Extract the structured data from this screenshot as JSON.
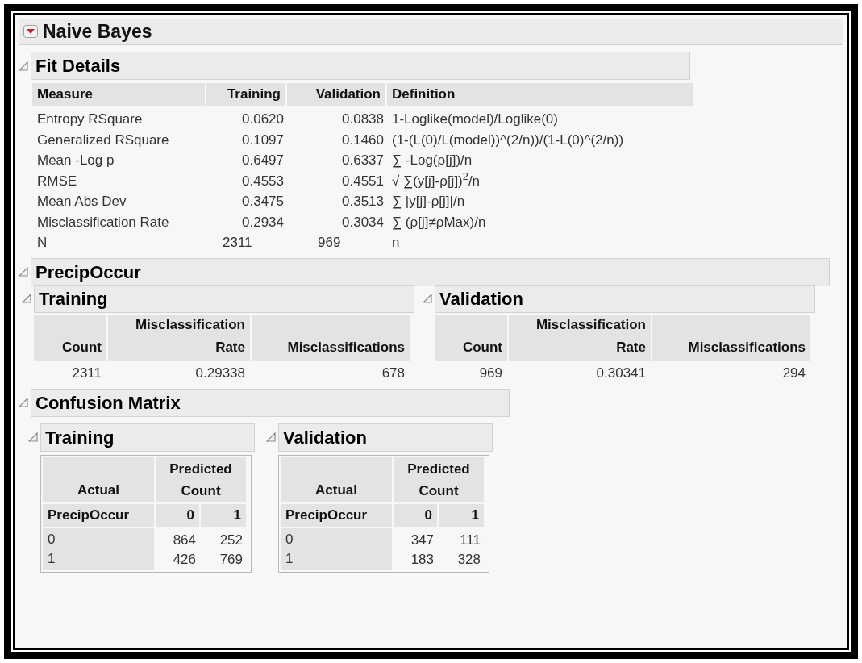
{
  "report": {
    "title": "Naive Bayes"
  },
  "fit_details": {
    "title": "Fit Details",
    "columns": [
      "Measure",
      "Training",
      "Validation",
      "Definition"
    ],
    "rows": [
      {
        "kind": "decimal",
        "measure": "Entropy RSquare",
        "training": "0.0620",
        "validation": "0.0838",
        "definition": "1-Loglike(model)/Loglike(0)"
      },
      {
        "kind": "decimal",
        "measure": "Generalized RSquare",
        "training": "0.1097",
        "validation": "0.1460",
        "definition": "(1-(L(0)/L(model))^(2/n))/(1-L(0)^(2/n))"
      },
      {
        "kind": "decimal",
        "measure": "Mean -Log p",
        "training": "0.6497",
        "validation": "0.6337",
        "definition": "∑ -Log(ρ[j])/n"
      },
      {
        "kind": "decimal",
        "measure": "RMSE",
        "training": "0.4553",
        "validation": "0.4551",
        "definition": "√ ∑(y[j]-ρ[j])$^{2}$/n"
      },
      {
        "kind": "decimal",
        "measure": "Mean Abs Dev",
        "training": "0.3475",
        "validation": "0.3513",
        "definition": "∑ |y[j]-ρ[j]|/n"
      },
      {
        "kind": "decimal",
        "measure": "Misclassification Rate",
        "training": "0.2934",
        "validation": "0.3034",
        "definition": "∑ (ρ[j]≠ρMax)/n"
      },
      {
        "kind": "count",
        "measure": "N",
        "training": "2311",
        "validation": "969",
        "definition": "n"
      }
    ]
  },
  "precip_occur": {
    "title": "PrecipOccur",
    "panels": [
      {
        "title": "Training",
        "columns": [
          "Count",
          "Misclassification Rate",
          "Misclassifications"
        ],
        "values": [
          "2311",
          "0.29338",
          "678"
        ]
      },
      {
        "title": "Validation",
        "columns": [
          "Count",
          "Misclassification Rate",
          "Misclassifications"
        ],
        "values": [
          "969",
          "0.30341",
          "294"
        ]
      }
    ]
  },
  "confusion_matrix": {
    "title": "Confusion Matrix",
    "panels": [
      {
        "title": "Training",
        "actual_label": "Actual",
        "predicted_label": "Predicted Count",
        "row_header": "PrecipOccur",
        "levels": [
          "0",
          "1"
        ],
        "rows": [
          {
            "label": "0",
            "values": [
              "864",
              "252"
            ]
          },
          {
            "label": "1",
            "values": [
              "426",
              "769"
            ]
          }
        ]
      },
      {
        "title": "Validation",
        "actual_label": "Actual",
        "predicted_label": "Predicted Count",
        "row_header": "PrecipOccur",
        "levels": [
          "0",
          "1"
        ],
        "rows": [
          {
            "label": "0",
            "values": [
              "347",
              "111"
            ]
          },
          {
            "label": "1",
            "values": [
              "183",
              "328"
            ]
          }
        ]
      }
    ]
  }
}
